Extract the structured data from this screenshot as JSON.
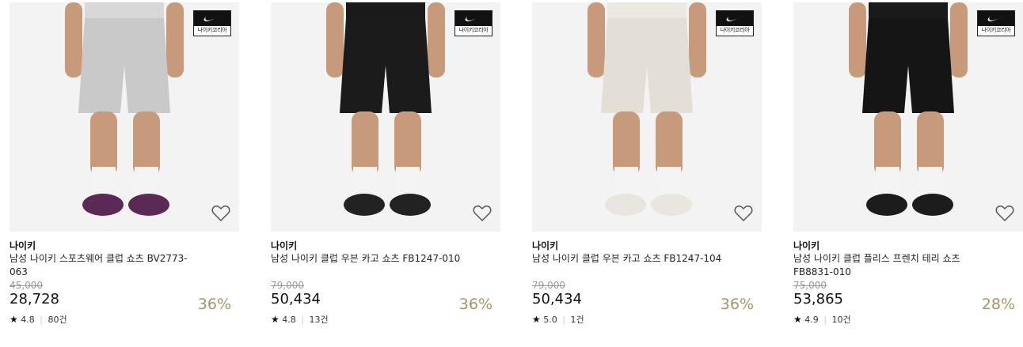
{
  "badge_text": "나이키코리아",
  "colors": {
    "discount": "#a89467",
    "image_bg": "#f3f3f3"
  },
  "products": [
    {
      "brand": "나이키",
      "name": "남성 나이키 스포츠웨어 클럽 쇼츠 BV2773-063",
      "original_price": "45,000",
      "price": "28,728",
      "discount": "36%",
      "rating": "4.8",
      "reviews": "80건",
      "shorts_color": "#c9c9c9",
      "shoe_color": "#5a2a55"
    },
    {
      "brand": "나이키",
      "name": "남성 나이키 클럽 우븐 카고 쇼츠 FB1247-010",
      "original_price": "79,000",
      "price": "50,434",
      "discount": "36%",
      "rating": "4.8",
      "reviews": "13건",
      "shorts_color": "#1b1b1b",
      "shoe_color": "#222222"
    },
    {
      "brand": "나이키",
      "name": "남성 나이키 클럽 우븐 카고 쇼츠 FB1247-104",
      "original_price": "79,000",
      "price": "50,434",
      "discount": "36%",
      "rating": "5.0",
      "reviews": "1건",
      "shorts_color": "#e4dfd6",
      "shoe_color": "#e9e6df"
    },
    {
      "brand": "나이키",
      "name": "남성 나이키 클럽 플리스 프렌치 테리 쇼츠 FB8831-010",
      "original_price": "75,000",
      "price": "53,865",
      "discount": "28%",
      "rating": "4.9",
      "reviews": "10건",
      "shorts_color": "#151515",
      "shoe_color": "#1c1c1c"
    }
  ]
}
